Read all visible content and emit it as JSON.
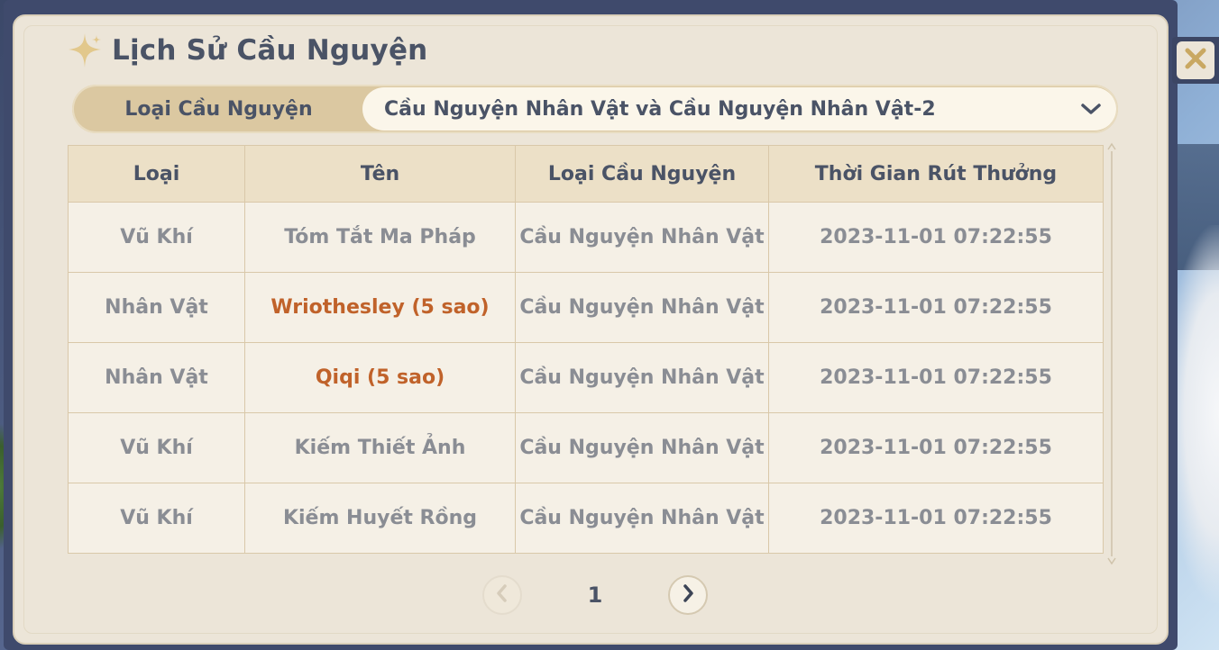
{
  "window": {
    "title": "Lịch Sử Cầu Nguyện",
    "close_icon": "close-icon",
    "title_icon": "sparkle-icon"
  },
  "filter": {
    "label": "Loại Cầu Nguyện",
    "selected": "Cầu Nguyện Nhân Vật và Cầu Nguyện Nhân Vật-2",
    "dropdown_icon": "chevron-down-icon"
  },
  "table": {
    "columns": [
      "Loại",
      "Tên",
      "Loại Cầu Nguyện",
      "Thời Gian Rút Thưởng"
    ],
    "rows": [
      {
        "type": "Vũ Khí",
        "name": "Tóm Tắt Ma Pháp",
        "wish": "Cầu Nguyện Nhân Vật",
        "time": "2023-11-01 07:22:55"
      },
      {
        "type": "Nhân Vật",
        "name": "Wriothesley (5 sao)",
        "wish": "Cầu Nguyện Nhân Vật",
        "time": "2023-11-01 07:22:55"
      },
      {
        "type": "Nhân Vật",
        "name": "Qiqi (5 sao)",
        "wish": "Cầu Nguyện Nhân Vật",
        "time": "2023-11-01 07:22:55"
      },
      {
        "type": "Vũ Khí",
        "name": "Kiếm Thiết Ảnh",
        "wish": "Cầu Nguyện Nhân Vật",
        "time": "2023-11-01 07:22:55"
      },
      {
        "type": "Vũ Khí",
        "name": "Kiếm Huyết Rồng",
        "wish": "Cầu Nguyện Nhân Vật",
        "time": "2023-11-01 07:22:55"
      }
    ]
  },
  "pagination": {
    "current_page": "1",
    "prev_icon": "chevron-left-icon",
    "next_icon": "chevron-right-icon"
  },
  "colors": {
    "five_star": "#c0622a",
    "panel": "#ece5d8",
    "text_dark": "#4a5366",
    "text_muted": "#8a8d94"
  }
}
